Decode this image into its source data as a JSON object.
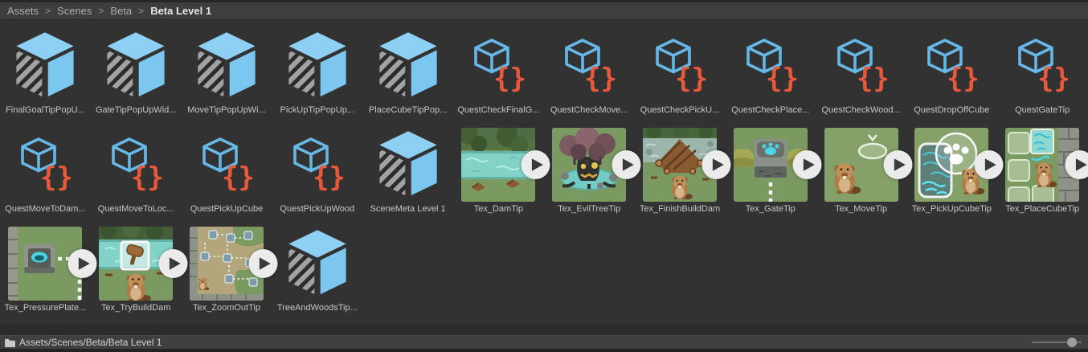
{
  "breadcrumb": {
    "segments": [
      "Assets",
      "Scenes",
      "Beta"
    ],
    "current": "Beta Level 1",
    "separator": ">"
  },
  "grid": {
    "items": [
      {
        "label": "FinalGoalTipPopU...",
        "type": "prefab",
        "row": 1
      },
      {
        "label": "GateTipPopUpWid...",
        "type": "prefab",
        "row": 1
      },
      {
        "label": "MoveTipPopUpWi...",
        "type": "prefab",
        "row": 1
      },
      {
        "label": "PickUpTipPopUp...",
        "type": "prefab",
        "row": 1
      },
      {
        "label": "PlaceCubeTipPop...",
        "type": "prefab",
        "row": 1
      },
      {
        "label": "QuestCheckFinalG...",
        "type": "so",
        "row": 1
      },
      {
        "label": "QuestCheckMove...",
        "type": "so",
        "row": 1
      },
      {
        "label": "QuestCheckPickU...",
        "type": "so",
        "row": 1
      },
      {
        "label": "QuestCheckPlace...",
        "type": "so",
        "row": 1
      },
      {
        "label": "QuestCheckWood...",
        "type": "so",
        "row": 1
      },
      {
        "label": "QuestDropOffCube",
        "type": "so",
        "row": 1
      },
      {
        "label": "QuestGateTip",
        "type": "so",
        "row": 1
      },
      {
        "label": "QuestMoveToDam...",
        "type": "so",
        "row": 2
      },
      {
        "label": "QuestMoveToLoc...",
        "type": "so",
        "row": 2
      },
      {
        "label": "QuestPickUpCube",
        "type": "so",
        "row": 2
      },
      {
        "label": "QuestPickUpWood",
        "type": "so",
        "row": 2
      },
      {
        "label": "SceneMeta Level 1",
        "type": "prefab",
        "row": 2
      },
      {
        "label": "Tex_DamTip",
        "type": "video",
        "thumb": "dam",
        "row": 2
      },
      {
        "label": "Tex_EvilTreeTip",
        "type": "video",
        "thumb": "evil-tree",
        "row": 2
      },
      {
        "label": "Tex_FinishBuildDam",
        "type": "video",
        "thumb": "finish-dam",
        "row": 2
      },
      {
        "label": "Tex_GateTip",
        "type": "video",
        "thumb": "gate",
        "row": 2
      },
      {
        "label": "Tex_MoveTip",
        "type": "video",
        "thumb": "move",
        "row": 2
      },
      {
        "label": "Tex_PickUpCubeTip",
        "type": "video",
        "thumb": "pickup",
        "row": 2
      },
      {
        "label": "Tex_PlaceCubeTip",
        "type": "video",
        "thumb": "place",
        "row": 2
      },
      {
        "label": "Tex_PressurePlate...",
        "type": "video",
        "thumb": "pressure",
        "row": 3
      },
      {
        "label": "Tex_TryBuildDam",
        "type": "video",
        "thumb": "try-dam",
        "row": 3
      },
      {
        "label": "Tex_ZoomOutTip",
        "type": "video",
        "thumb": "zoom-out",
        "row": 3
      },
      {
        "label": "TreeAndWoodsTip...",
        "type": "prefab",
        "row": 3
      }
    ]
  },
  "status_bar": {
    "path": "Assets/Scenes/Beta/Beta Level 1"
  },
  "icons": {
    "so_braces_text": "{}"
  },
  "colors": {
    "background": "#323232",
    "breadcrumb_bar": "#3e3e3e",
    "status_bar": "#404040",
    "label_text": "#c6c6c6",
    "prefab_blue_top": "#8dd0f4",
    "prefab_blue_side": "#7cc7ef",
    "prefab_stripe": "#a2a2a2",
    "so_cube_outline": "#66b8e6",
    "so_braces": "#e8593b",
    "play_circle": "#ebebeb",
    "play_triangle": "#3a3a3a",
    "slider_track": "#717171",
    "slider_knob": "#9c9c9c"
  }
}
